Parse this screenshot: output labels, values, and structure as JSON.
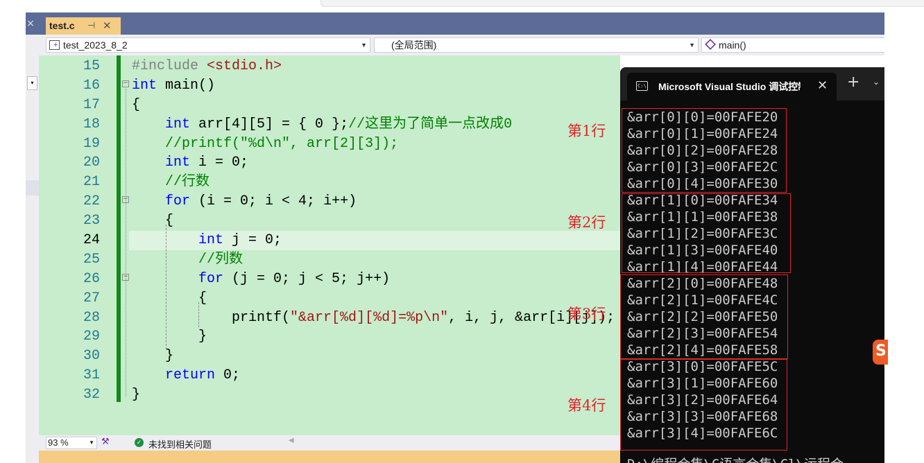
{
  "tab": {
    "name": "test.c",
    "pin_icon": "pin-icon",
    "close_icon": "close-icon"
  },
  "left_tab": {
    "close_glyph": "×"
  },
  "nav": {
    "project": "test_2023_8_2",
    "scope": "(全局范围)",
    "function": "main()"
  },
  "code": {
    "line_numbers": [
      "15",
      "16",
      "17",
      "18",
      "19",
      "20",
      "21",
      "22",
      "23",
      "24",
      "25",
      "26",
      "27",
      "28",
      "29",
      "30",
      "31",
      "32"
    ],
    "current_line": "24"
  },
  "status": {
    "zoom": "93 %",
    "issues": "未找到相关问题"
  },
  "console": {
    "title": "Microsoft Visual Studio 调试控制台",
    "output": [
      "&arr[0][0]=00FAFE20",
      "&arr[0][1]=00FAFE24",
      "&arr[0][2]=00FAFE28",
      "&arr[0][3]=00FAFE2C",
      "&arr[0][4]=00FAFE30",
      "&arr[1][0]=00FAFE34",
      "&arr[1][1]=00FAFE38",
      "&arr[1][2]=00FAFE3C",
      "&arr[1][3]=00FAFE40",
      "&arr[1][4]=00FAFE44",
      "&arr[2][0]=00FAFE48",
      "&arr[2][1]=00FAFE4C",
      "&arr[2][2]=00FAFE50",
      "&arr[2][3]=00FAFE54",
      "&arr[2][4]=00FAFE58",
      "&arr[3][0]=00FAFE5C",
      "&arr[3][1]=00FAFE60",
      "&arr[3][2]=00FAFE64",
      "&arr[3][3]=00FAFE68",
      "&arr[3][4]=00FAFE6C"
    ],
    "path_line": "D:\\编程合集\\C语言合集\\Cl\\运程合"
  },
  "annotations": [
    "第1行",
    "第2行",
    "第3行",
    "第4行"
  ],
  "colors": {
    "editor_bg": "#c7edcc",
    "tab_active": "#f5cc84",
    "tabbar": "#5d6b99",
    "annotation_red": "#e0242c",
    "keyword": "#0000ff",
    "comment": "#008000",
    "string": "#a31515"
  }
}
